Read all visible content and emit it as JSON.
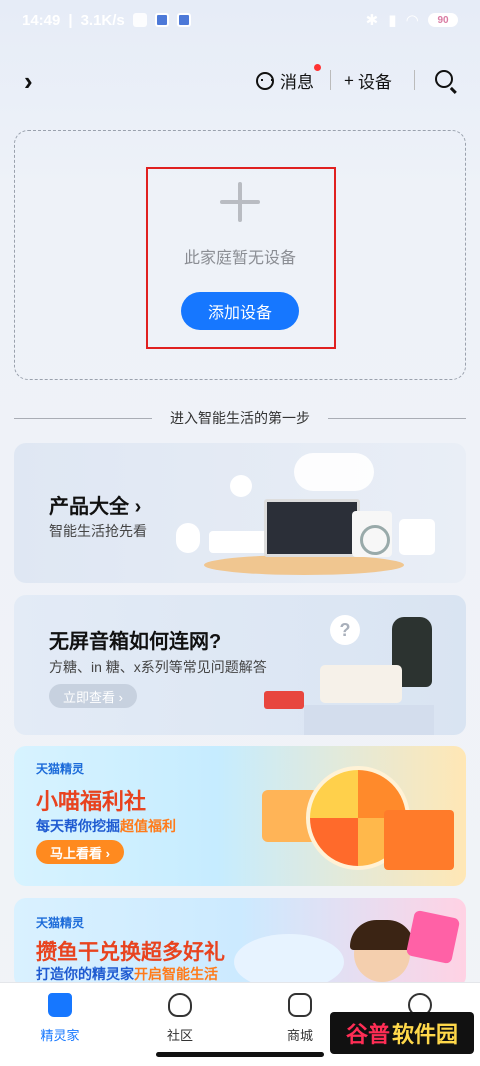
{
  "status_bar": {
    "time": "14:49",
    "speed": "3.1K/s",
    "battery": "90"
  },
  "header": {
    "messages_label": "消息",
    "add_device_label": "设备",
    "add_symbol": "+"
  },
  "empty_state": {
    "text": "此家庭暂无设备",
    "add_button": "添加设备"
  },
  "divider": {
    "text": "进入智能生活的第一步"
  },
  "cards": [
    {
      "title": "产品大全",
      "arrow": "›",
      "subtitle": "智能生活抢先看"
    },
    {
      "title": "无屏音箱如何连网?",
      "subtitle": "方糖、in 糖、x系列等常见问题解答",
      "button": "立即查看 ›"
    },
    {
      "brand": "天猫精灵",
      "title": "小喵福利社",
      "subtitle_a": "每天帮你挖掘",
      "subtitle_b": "超值福利",
      "button": "马上看看 ›"
    },
    {
      "brand": "天猫精灵",
      "title": "攒鱼干兑换超多好礼",
      "subtitle_a": "打造你的精灵家",
      "subtitle_b": "开启智能生活"
    }
  ],
  "bottom_nav": [
    {
      "label": "精灵家",
      "active": true
    },
    {
      "label": "社区",
      "active": false
    },
    {
      "label": "商城",
      "active": false
    },
    {
      "label": "",
      "active": false
    }
  ],
  "watermark": {
    "part_a": "谷普",
    "part_b": "软件园"
  },
  "colors": {
    "accent": "#1677ff",
    "highlight_border": "#e02020"
  }
}
